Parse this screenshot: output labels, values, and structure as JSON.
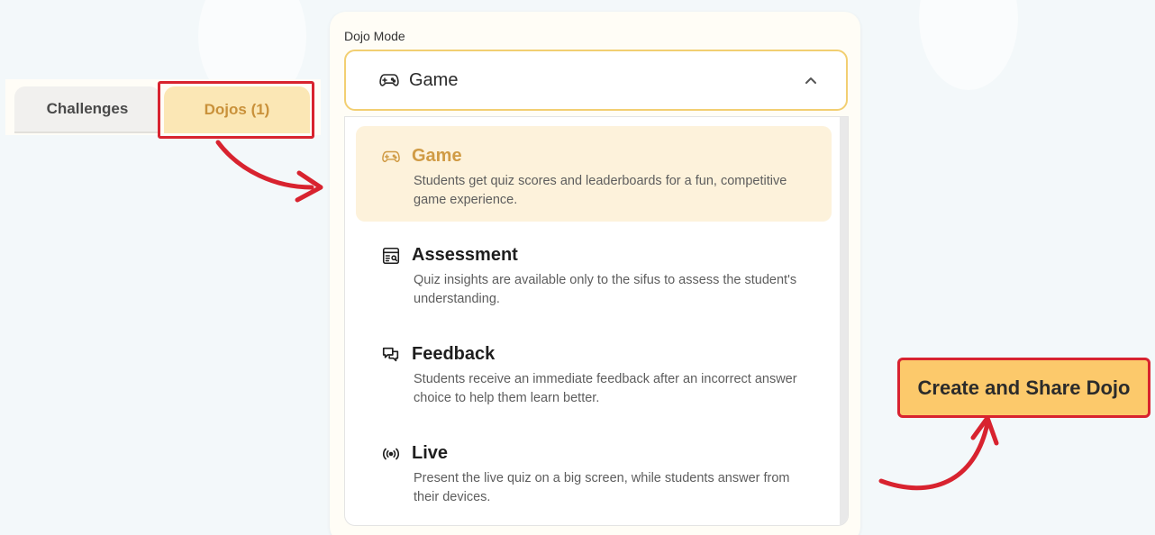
{
  "tabs": {
    "challenges": "Challenges",
    "dojos": "Dojos (1)"
  },
  "dojo_mode": {
    "label": "Dojo Mode",
    "selected_value": "Game",
    "options": [
      {
        "title": "Game",
        "description": "Students get quiz scores and leaderboards for a fun, competitive game experience.",
        "icon": "gamepad-icon",
        "selected": true
      },
      {
        "title": "Assessment",
        "description": "Quiz insights are available only to the sifus to assess the student's understanding.",
        "icon": "assessment-report-icon",
        "selected": false
      },
      {
        "title": "Feedback",
        "description": "Students receive an immediate feedback after an incorrect answer choice to help them learn better.",
        "icon": "chat-bubbles-icon",
        "selected": false
      },
      {
        "title": "Live",
        "description": "Present the live quiz on a big screen, while students answer from their devices.",
        "icon": "broadcast-icon",
        "selected": false
      }
    ]
  },
  "actions": {
    "create_share": "Create and Share Dojo"
  },
  "colors": {
    "accent": "#fcc96b",
    "selected_bg": "#fdf2db",
    "selected_text": "#d09b45",
    "annotation_red": "#d8232f",
    "select_border": "#f2cf72"
  }
}
